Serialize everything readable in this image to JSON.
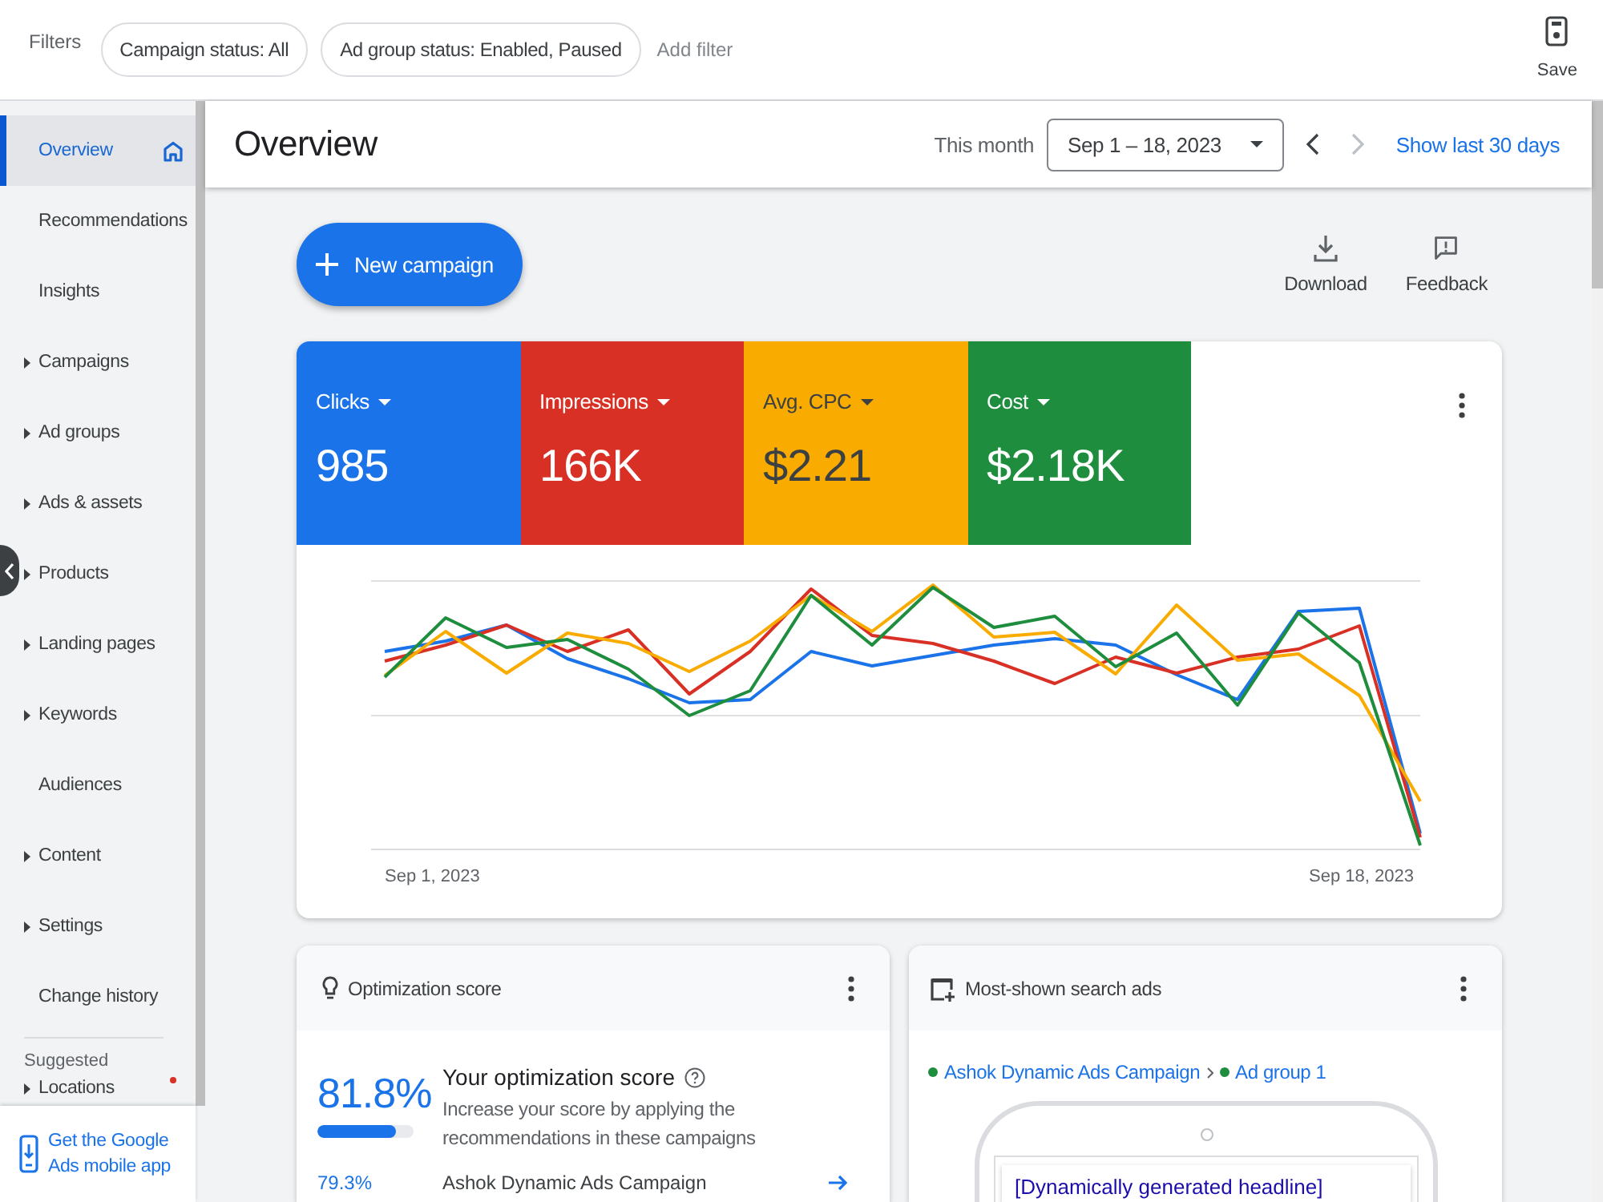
{
  "filter_bar": {
    "label": "Filters",
    "chips": [
      {
        "label": "Campaign status: All"
      },
      {
        "label": "Ad group status: Enabled, Paused"
      }
    ],
    "add_filter": "Add filter",
    "save": "Save"
  },
  "sidebar": {
    "items": [
      {
        "label": "Overview",
        "selected": true,
        "expandable": false,
        "home": true,
        "notification": false
      },
      {
        "label": "Recommendations",
        "selected": false,
        "expandable": false,
        "home": false,
        "notification": false
      },
      {
        "label": "Insights",
        "selected": false,
        "expandable": false,
        "home": false,
        "notification": false
      },
      {
        "label": "Campaigns",
        "selected": false,
        "expandable": true,
        "home": false,
        "notification": false
      },
      {
        "label": "Ad groups",
        "selected": false,
        "expandable": true,
        "home": false,
        "notification": false
      },
      {
        "label": "Ads & assets",
        "selected": false,
        "expandable": true,
        "home": false,
        "notification": false
      },
      {
        "label": "Products",
        "selected": false,
        "expandable": true,
        "home": false,
        "notification": false
      },
      {
        "label": "Landing pages",
        "selected": false,
        "expandable": true,
        "home": false,
        "notification": false
      },
      {
        "label": "Keywords",
        "selected": false,
        "expandable": true,
        "home": false,
        "notification": false
      },
      {
        "label": "Audiences",
        "selected": false,
        "expandable": false,
        "home": false,
        "notification": false
      },
      {
        "label": "Content",
        "selected": false,
        "expandable": true,
        "home": false,
        "notification": false
      },
      {
        "label": "Settings",
        "selected": false,
        "expandable": true,
        "home": false,
        "notification": false
      },
      {
        "label": "Change history",
        "selected": false,
        "expandable": false,
        "home": false,
        "notification": false
      }
    ],
    "suggested": {
      "heading": "Suggested",
      "items": [
        {
          "label": "Locations",
          "selected": false,
          "expandable": true,
          "home": false,
          "notification": true
        }
      ]
    },
    "mobile_app_link": "Get the Google Ads mobile app"
  },
  "header": {
    "title": "Overview",
    "range_label": "This month",
    "date_range": "Sep 1 – 18, 2023",
    "nav_buttons": [
      {
        "kind": "previous",
        "disabled": false
      },
      {
        "kind": "next",
        "disabled": true
      }
    ],
    "link": "Show last 30 days"
  },
  "actions": {
    "new_campaign": "New campaign",
    "tools": [
      {
        "kind": "download",
        "label": "Download"
      },
      {
        "kind": "feedback",
        "label": "Feedback"
      }
    ]
  },
  "performance": {
    "metrics": [
      {
        "label": "Clicks",
        "value": "985",
        "color": "#1a73e8",
        "selected": true
      },
      {
        "label": "Impressions",
        "value": "166K",
        "color": "#d93025",
        "selected": true
      },
      {
        "label": "Avg. CPC",
        "value": "$2.21",
        "color": "#f9ab00",
        "selected": true
      },
      {
        "label": "Cost",
        "value": "$2.18K",
        "color": "#1e8e3e",
        "selected": true
      }
    ],
    "x_labels": [
      "Sep 1, 2023",
      "Sep 18, 2023"
    ]
  },
  "optimization": {
    "title": "Optimization score",
    "score": "81.8%",
    "level": 0.818,
    "heading": "Your optimization score",
    "description": "Increase your score by applying the recommendations in these campaigns",
    "campaigns": [
      {
        "score": "79.3%",
        "name": "Ashok Dynamic Ads Campaign"
      }
    ]
  },
  "search_ads": {
    "title": "Most-shown search ads",
    "breadcrumb": [
      {
        "label": "Ashok Dynamic Ads Campaign",
        "color": "#1e8e3e"
      },
      {
        "label": "Ad group 1",
        "color": "#1e8e3e"
      }
    ],
    "headline": "[Dynamically generated headline]"
  }
}
